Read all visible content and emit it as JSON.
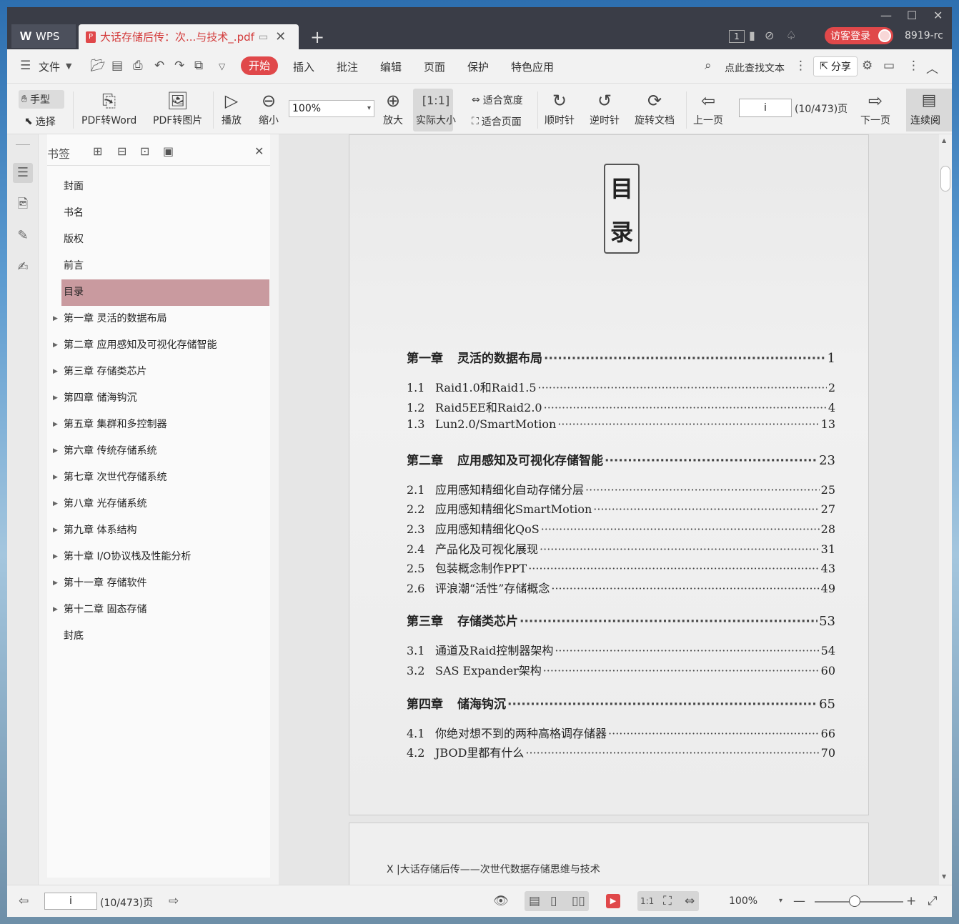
{
  "titlebar": {
    "app_tab": "WPS",
    "app_logo": "W",
    "doc_tab_title": "大话存储后传：次...与技术_.pdf",
    "visitor_login": "访客登录",
    "user_id": "8919-rc",
    "page_indicator": "1"
  },
  "menubar": {
    "file": "文件",
    "items": [
      "开始",
      "插入",
      "批注",
      "编辑",
      "页面",
      "保护",
      "特色应用"
    ],
    "search": "点此查找文本",
    "share": "分享"
  },
  "toolbar": {
    "hand": "手型",
    "select": "选择",
    "pdf_to_word": "PDF转Word",
    "pdf_to_image": "PDF转图片",
    "play": "播放",
    "zoom_out": "缩小",
    "zoom_value": "100%",
    "zoom_in": "放大",
    "actual_size": "实际大小",
    "fit_width": "适合宽度",
    "fit_page": "适合页面",
    "clockwise": "顺时针",
    "counter_clockwise": "逆时针",
    "rotate_doc": "旋转文档",
    "prev_page": "上一页",
    "page_input": "i",
    "page_count": "(10/473)页",
    "next_page": "下一页",
    "continuous": "连续阅"
  },
  "sidebar": {
    "title": "书签",
    "items": [
      {
        "label": "封面",
        "expandable": false
      },
      {
        "label": "书名",
        "expandable": false
      },
      {
        "label": "版权",
        "expandable": false
      },
      {
        "label": "前言",
        "expandable": false
      },
      {
        "label": "目录",
        "expandable": false,
        "selected": true
      },
      {
        "label": "第一章 灵活的数据布局",
        "expandable": true
      },
      {
        "label": "第二章 应用感知及可视化存储智能",
        "expandable": true
      },
      {
        "label": "第三章 存储类芯片",
        "expandable": true
      },
      {
        "label": "第四章 储海钩沉",
        "expandable": true
      },
      {
        "label": "第五章 集群和多控制器",
        "expandable": true
      },
      {
        "label": "第六章 传统存储系统",
        "expandable": true
      },
      {
        "label": "第七章 次世代存储系统",
        "expandable": true
      },
      {
        "label": "第八章 光存储系统",
        "expandable": true
      },
      {
        "label": "第九章 体系结构",
        "expandable": true
      },
      {
        "label": "第十章 I/O协议栈及性能分析",
        "expandable": true
      },
      {
        "label": "第十一章 存储软件",
        "expandable": true
      },
      {
        "label": "第十二章 固态存储",
        "expandable": true
      },
      {
        "label": "封底",
        "expandable": false
      }
    ]
  },
  "page": {
    "heading_chars": [
      "目",
      "录"
    ],
    "toc": [
      {
        "kind": "chap",
        "num": "第一章",
        "title": "灵活的数据布局",
        "page": "1"
      },
      {
        "kind": "sec",
        "num": "1.1",
        "title": "Raid1.0和Raid1.5",
        "page": "2"
      },
      {
        "kind": "sec",
        "num": "1.2",
        "title": "Raid5EE和Raid2.0",
        "page": "4"
      },
      {
        "kind": "sec",
        "num": "1.3",
        "title": "Lun2.0/SmartMotion",
        "page": "13"
      },
      {
        "kind": "chap",
        "num": "第二章",
        "title": "应用感知及可视化存储智能",
        "page": "23"
      },
      {
        "kind": "sec",
        "num": "2.1",
        "title": "应用感知精细化自动存储分层",
        "page": "25"
      },
      {
        "kind": "sec",
        "num": "2.2",
        "title": "应用感知精细化SmartMotion",
        "page": "27"
      },
      {
        "kind": "sec",
        "num": "2.3",
        "title": "应用感知精细化QoS",
        "page": "28"
      },
      {
        "kind": "sec",
        "num": "2.4",
        "title": "产品化及可视化展现",
        "page": "31"
      },
      {
        "kind": "sec",
        "num": "2.5",
        "title": "包装概念制作PPT",
        "page": "43"
      },
      {
        "kind": "sec",
        "num": "2.6",
        "title": "评浪潮“活性”存储概念",
        "page": "49"
      },
      {
        "kind": "chap",
        "num": "第三章",
        "title": "存储类芯片",
        "page": "53"
      },
      {
        "kind": "sec",
        "num": "3.1",
        "title": "通道及Raid控制器架构",
        "page": "54"
      },
      {
        "kind": "sec",
        "num": "3.2",
        "title": "SAS Expander架构",
        "page": "60"
      },
      {
        "kind": "chap",
        "num": "第四章",
        "title": "储海钩沉",
        "page": "65"
      },
      {
        "kind": "sec",
        "num": "4.1",
        "title": "你绝对想不到的两种高格调存储器",
        "page": "66"
      },
      {
        "kind": "sec",
        "num": "4.2",
        "title": "JBOD里都有什么",
        "page": "70"
      }
    ],
    "next_page_footer": "X  |大话存储后传——次世代数据存储思维与技术"
  },
  "statusbar": {
    "page_input": "i",
    "page_count": "(10/473)页",
    "zoom": "100%"
  }
}
